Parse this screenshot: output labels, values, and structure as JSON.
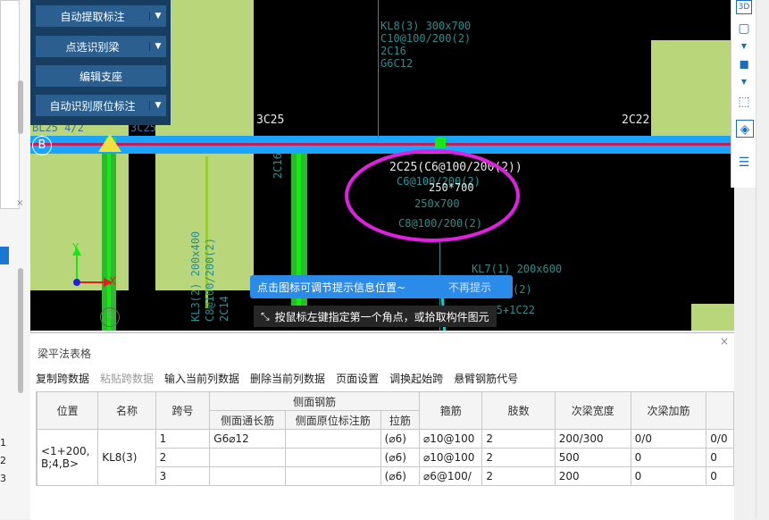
{
  "menu": {
    "items": [
      {
        "label": "自动提取标注",
        "has_dropdown": true
      },
      {
        "label": "点选识别梁",
        "has_dropdown": true
      },
      {
        "label": "编辑支座",
        "has_dropdown": false
      },
      {
        "label": "自动识别原位标注",
        "has_dropdown": true
      }
    ]
  },
  "canvas": {
    "axis_b": "B",
    "axis_3": "3",
    "kl8_lines": [
      "KL8(3) 300x700",
      "C10@100/200(2)",
      "2C16",
      "G6C12"
    ],
    "label_3c25": "3C25",
    "label_2c22": "2C22",
    "label_bl": "BL25 4/2",
    "label_3c25_left": "3C25",
    "annot_top": "2C25(C6@100/200(2))",
    "annot_overlap": "C6@100/200(2)",
    "annot_size1": "250*700",
    "annot_size2": "250x700",
    "annot_stirrup": "C8@100/200(2)",
    "vert_2c16": "2C16",
    "vert_kl3": "KL3(2) 200x400",
    "vert_2": "C8@100/200(2)",
    "vert_3": "2C14",
    "kl7": "KL7(1) 200x600",
    "kl7_b": "(2)",
    "kl7_c": "2C25+1C22",
    "axis_x": "X",
    "axis_y": "Y"
  },
  "tip": {
    "text": "点击图标可调节提示信息位置~",
    "dismiss": "不再提示"
  },
  "status": {
    "text": "按鼠标左键指定第一个角点，或拾取构件图元"
  },
  "panel": {
    "title": "梁平法表格",
    "close": "×",
    "toolbar": [
      "复制跨数据",
      "粘贴跨数据",
      "输入当前列数据",
      "删除当前列数据",
      "页面设置",
      "调换起始跨",
      "悬臂钢筋代号"
    ],
    "disabled": [
      1
    ],
    "headers": {
      "position": "位置",
      "name": "名称",
      "span": "跨号",
      "side_group": "侧面钢筋",
      "side_long": "侧面通长筋",
      "side_inplace": "侧面原位标注筋",
      "tie": "拉筋",
      "stirrup": "箍筋",
      "legs": "肢数",
      "sec_width": "次梁宽度",
      "sec_add": "次梁加筋"
    },
    "position_value": "<1+200,\nB;4,B>",
    "name_value": "KL8(3)",
    "rows": [
      {
        "num": "1",
        "span": "1",
        "side_long": "G6⌀12",
        "side_inplace": "",
        "tie": "(⌀6)",
        "stirrup": "⌀10@100",
        "legs": "2",
        "sec_width": "200/300",
        "sec_add": "0/0",
        "extra": "0/0"
      },
      {
        "num": "2",
        "span": "2",
        "side_long": "",
        "side_inplace": "",
        "tie": "(⌀6)",
        "stirrup": "⌀10@100",
        "legs": "2",
        "sec_width": "500",
        "sec_add": "0",
        "extra": "0"
      },
      {
        "num": "3",
        "span": "3",
        "side_long": "",
        "side_inplace": "",
        "tie": "(⌀6)",
        "stirrup": "⌀6@100/",
        "legs": "2",
        "sec_width": "200",
        "sec_add": "0",
        "extra": "0"
      }
    ]
  },
  "colors": {
    "beam": "#1aa3ff",
    "ellipse": "#e020e0",
    "arrow": "#1ac8c8",
    "wall": "#b9d77a"
  }
}
